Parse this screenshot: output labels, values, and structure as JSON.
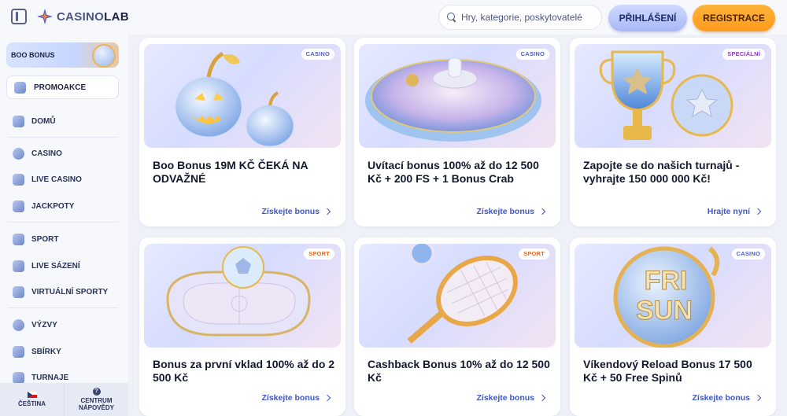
{
  "header": {
    "logo_prefix": "CASINO",
    "logo_suffix": "LAB",
    "search_placeholder": "Hry, kategorie, poskytovatelé",
    "login_label": "PŘIHLÁŠENÍ",
    "register_label": "REGISTRACE"
  },
  "sidebar": {
    "boo_label": "BOO BONUS",
    "promo_label": "PROMOAKCE",
    "items": [
      {
        "label": "DOMŮ",
        "icon": "home-icon"
      },
      {
        "label": "CASINO",
        "icon": "casino-chip-icon"
      },
      {
        "label": "LIVE CASINO",
        "icon": "live-casino-icon"
      },
      {
        "label": "JACKPOTY",
        "icon": "jackpot-icon"
      },
      {
        "label": "SPORT",
        "icon": "sport-icon"
      },
      {
        "label": "LIVE SÁZENÍ",
        "icon": "live-betting-icon"
      },
      {
        "label": "VIRTUÁLNÍ SPORTY",
        "icon": "virtual-sports-icon"
      },
      {
        "label": "VÝZVY",
        "icon": "challenges-icon"
      },
      {
        "label": "SBÍRKY",
        "icon": "collections-icon"
      },
      {
        "label": "TURNAJE",
        "icon": "tournaments-icon"
      }
    ],
    "language_label": "ČEŠTINA",
    "help_label": "CENTRUM NÁPOVĚDY"
  },
  "cards": [
    {
      "badge": "CASINO",
      "title": "Boo Bonus 19M KČ ČEKÁ NA ODVAŽNÉ",
      "link": "Získejte bonus"
    },
    {
      "badge": "CASINO",
      "title": "Uvítací bonus 100% až do 12 500 Kč + 200 FS + 1 Bonus Crab",
      "link": "Získejte bonus"
    },
    {
      "badge": "SPECIÁLNÍ",
      "title": "Zapojte se do našich turnajů - vyhrajte 150 000 000 Kč!",
      "link": "Hrajte nyní"
    },
    {
      "badge": "SPORT",
      "title": "Bonus za první vklad 100% až do 2 500 Kč",
      "link": "Získejte bonus"
    },
    {
      "badge": "SPORT",
      "title": "Cashback Bonus 10% až do 12 500 Kč",
      "link": "Získejte bonus"
    },
    {
      "badge": "CASINO",
      "title": "Víkendový Reload Bonus 17 500 Kč + 50 Free Spinů",
      "link": "Získejte bonus"
    }
  ],
  "art_text": {
    "fri": "FRI",
    "sun": "SUN"
  }
}
